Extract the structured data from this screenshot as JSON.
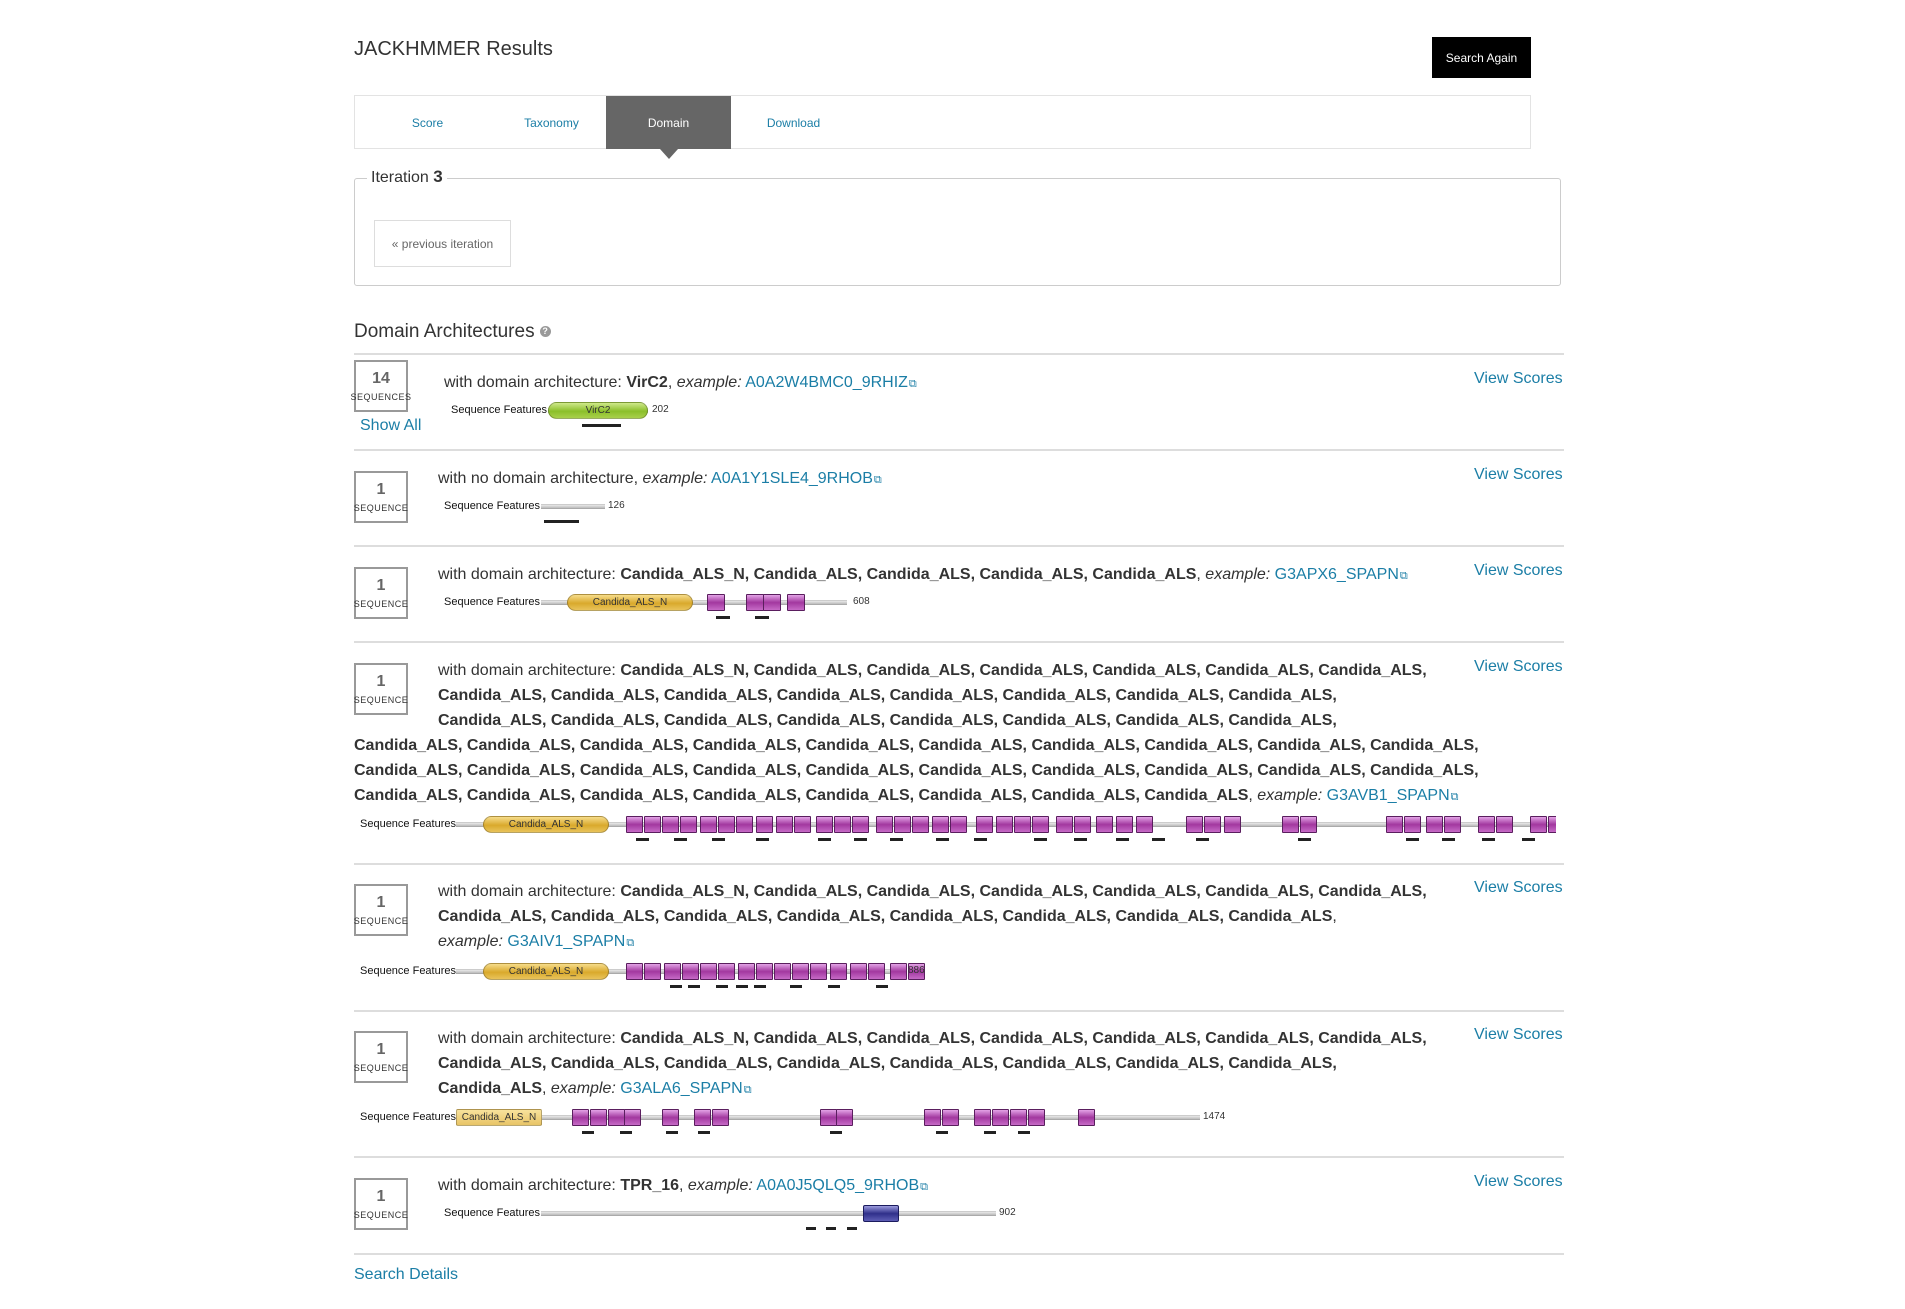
{
  "header": {
    "title": "JACKHMMER Results",
    "search_again_label": "Search Again"
  },
  "tabs": [
    {
      "label": "Score"
    },
    {
      "label": "Taxonomy"
    },
    {
      "label": "Domain",
      "active": true
    },
    {
      "label": "Download"
    }
  ],
  "iteration": {
    "label": "Iteration",
    "number": "3",
    "prev_label": "« previous iteration"
  },
  "section": {
    "title": "Domain Architectures",
    "help_icon": "question-circle-icon"
  },
  "rows": [
    {
      "count": "14",
      "count_label": "SEQUENCES",
      "show_all": "Show All",
      "prefix": "with domain architecture: ",
      "arch": "VirC2",
      "example_label": "example:",
      "example": "A0A2W4BMC0_9RHIZ",
      "view_scores": "View Scores",
      "seq_features": "Sequence Features",
      "length": "202",
      "domain_names": [
        "VirC2"
      ]
    },
    {
      "count": "1",
      "count_label": "SEQUENCE",
      "prefix": "with no domain architecture",
      "arch": "",
      "example_label": "example:",
      "example": "A0A1Y1SLE4_9RHOB",
      "view_scores": "View Scores",
      "seq_features": "Sequence Features",
      "length": "126"
    },
    {
      "count": "1",
      "count_label": "SEQUENCE",
      "prefix": "with domain architecture: ",
      "arch": "Candida_ALS_N, Candida_ALS, Candida_ALS, Candida_ALS, Candida_ALS",
      "example_label": "example:",
      "example": "G3APX6_SPAPN",
      "view_scores": "View Scores",
      "seq_features": "Sequence Features",
      "length": "608",
      "domain_names": [
        "Candida_ALS_N"
      ]
    },
    {
      "count": "1",
      "count_label": "SEQUENCE",
      "prefix": "with domain architecture: ",
      "arch_lines": [
        "Candida_ALS_N, Candida_ALS, Candida_ALS, Candida_ALS, Candida_ALS, Candida_ALS, Candida_ALS,",
        "Candida_ALS, Candida_ALS, Candida_ALS, Candida_ALS, Candida_ALS, Candida_ALS, Candida_ALS, Candida_ALS,",
        "Candida_ALS, Candida_ALS, Candida_ALS, Candida_ALS, Candida_ALS, Candida_ALS, Candida_ALS, Candida_ALS,",
        "Candida_ALS, Candida_ALS, Candida_ALS, Candida_ALS, Candida_ALS, Candida_ALS, Candida_ALS, Candida_ALS, Candida_ALS, Candida_ALS,",
        "Candida_ALS, Candida_ALS, Candida_ALS, Candida_ALS, Candida_ALS, Candida_ALS, Candida_ALS, Candida_ALS, Candida_ALS, Candida_ALS,",
        "Candida_ALS, Candida_ALS, Candida_ALS, Candida_ALS, Candida_ALS, Candida_ALS, Candida_ALS, Candida_ALS"
      ],
      "example_label": "example:",
      "example": "G3AVB1_SPAPN",
      "view_scores": "View Scores",
      "seq_features": "Sequence Features",
      "domain_names": [
        "Candida_ALS_N"
      ]
    },
    {
      "count": "1",
      "count_label": "SEQUENCE",
      "prefix": "with domain architecture: ",
      "arch_lines": [
        "Candida_ALS_N, Candida_ALS, Candida_ALS, Candida_ALS, Candida_ALS, Candida_ALS, Candida_ALS,",
        "Candida_ALS, Candida_ALS, Candida_ALS, Candida_ALS, Candida_ALS, Candida_ALS, Candida_ALS, Candida_ALS"
      ],
      "example_label": "example:",
      "example": "G3AIV1_SPAPN",
      "view_scores": "View Scores",
      "seq_features": "Sequence Features",
      "length": "886",
      "domain_names": [
        "Candida_ALS_N"
      ]
    },
    {
      "count": "1",
      "count_label": "SEQUENCE",
      "prefix": "with domain architecture: ",
      "arch_lines": [
        "Candida_ALS_N, Candida_ALS, Candida_ALS, Candida_ALS, Candida_ALS, Candida_ALS, Candida_ALS,",
        "Candida_ALS, Candida_ALS, Candida_ALS, Candida_ALS, Candida_ALS, Candida_ALS, Candida_ALS, Candida_ALS,",
        "Candida_ALS"
      ],
      "example_label": "example:",
      "example": "G3ALA6_SPAPN",
      "view_scores": "View Scores",
      "seq_features": "Sequence Features",
      "length": "1474",
      "domain_names": [
        "Candida_ALS_N"
      ]
    },
    {
      "count": "1",
      "count_label": "SEQUENCE",
      "prefix": "with domain architecture: ",
      "arch": "TPR_16",
      "example_label": "example:",
      "example": "A0A0J5QLQ5_9RHOB",
      "view_scores": "View Scores",
      "seq_features": "Sequence Features",
      "length": "902"
    }
  ],
  "footer": {
    "search_details": "Search Details"
  },
  "colors": {
    "link": "#1b7ea6",
    "active_tab": "#666666",
    "domain_purple": "#a2389f",
    "domain_gold": "#d9a92c",
    "domain_green": "#8bbf2a",
    "domain_blue": "#2f2f8a"
  },
  "icons": {
    "external_link": "external-link-icon"
  }
}
